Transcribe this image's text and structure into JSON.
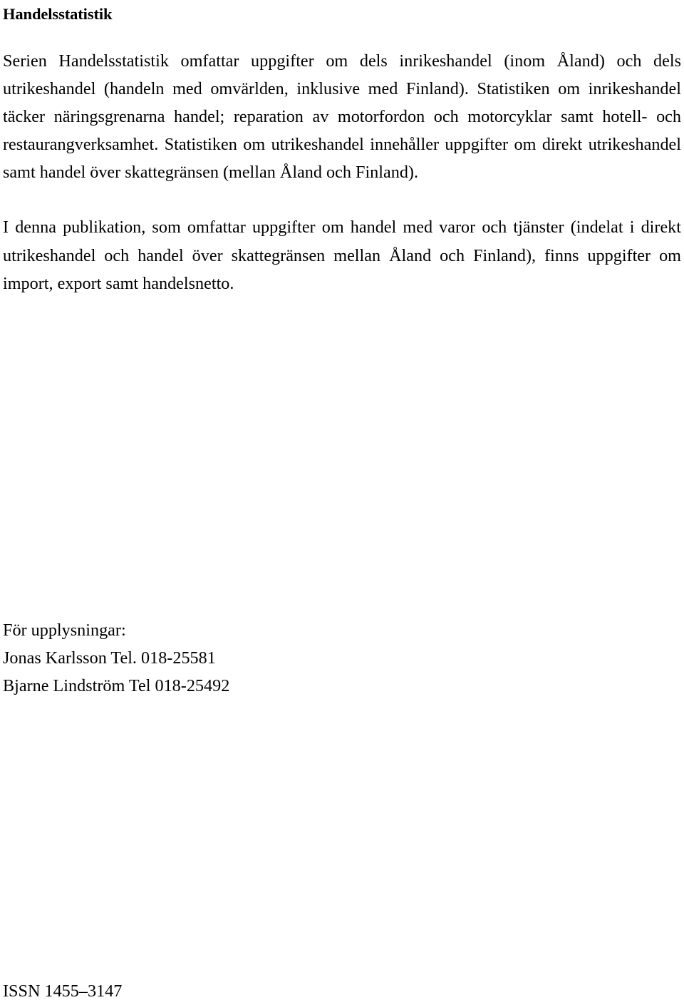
{
  "document": {
    "title": "Handelsstatistik",
    "paragraphs": [
      "Serien Handelsstatistik omfattar uppgifter om dels inrikeshandel (inom Åland) och dels utrikeshandel (handeln med omvärlden, inklusive med Finland). Statistiken om inrikeshandel täcker näringsgrenarna handel; reparation av motorfordon och motorcyklar samt hotell- och restaurangverksamhet. Statistiken om utrikeshandel innehåller uppgifter om direkt utrikeshandel samt handel över skattegränsen (mellan Åland och Finland).",
      "I denna publikation, som omfattar uppgifter om handel med varor och tjänster (indelat i direkt utrikeshandel och handel över skattegränsen mellan Åland och Finland), finns uppgifter om import, export samt handelsnetto."
    ],
    "contact": {
      "heading": "För upplysningar:",
      "lines": [
        "Jonas Karlsson Tel. 018-25581",
        "Bjarne Lindström Tel 018-25492"
      ]
    },
    "footer": {
      "issn": "ISSN 1455–3147"
    },
    "colors": {
      "text": "#000000",
      "background": "#ffffff"
    }
  }
}
